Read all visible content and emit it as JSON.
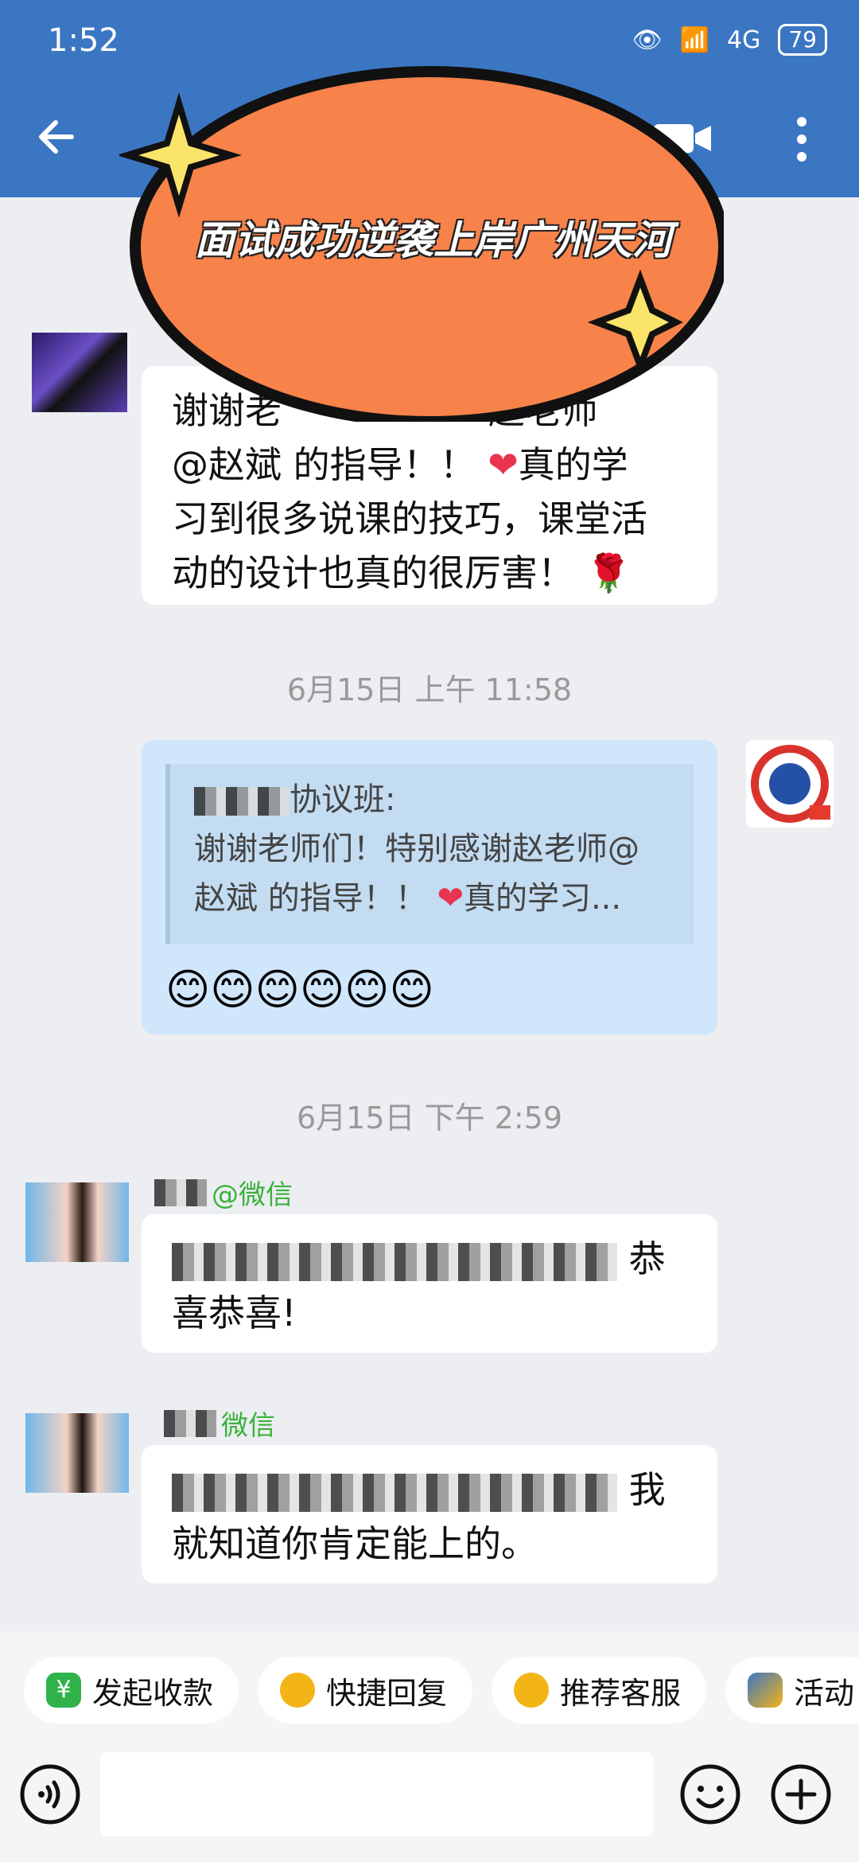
{
  "status_bar": {
    "time": "1:52",
    "network": "4G",
    "battery": "79"
  },
  "banner": {
    "text": "面试成功逆袭上岸广州天河"
  },
  "messages": {
    "first_bubble_lines": [
      "谢谢老",
      "赵老师",
      "@赵斌 的指导！！",
      "真的学",
      "习到很多说课的技巧，课堂活",
      "动的设计也真的很厉害！"
    ],
    "timestamp_1": "6月15日  上午 11:58",
    "quote": {
      "sender": "协议班:",
      "line1": "谢谢老师们！特别感谢赵老师@",
      "line2": "赵斌 的指导！！",
      "line2_end": "真的学习..."
    },
    "emoji_row": "😊😊😊😊😊😊",
    "timestamp_2": "6月15日  下午 2:59",
    "msg3": {
      "sender_suffix": "@微信",
      "text_end": "恭",
      "line2": "喜恭喜!"
    },
    "msg4": {
      "sender_suffix": "微信",
      "text_end": "我",
      "line2": "就知道你肯定能上的。"
    }
  },
  "quick_replies": [
    {
      "label": "发起收款",
      "icon": "yuan-icon",
      "color": "#2fb24a"
    },
    {
      "label": "快捷回复",
      "icon": "quick-reply-icon",
      "color": "#f3b416"
    },
    {
      "label": "推荐客服",
      "icon": "service-icon",
      "color": "#f3b416"
    },
    {
      "label": "活动",
      "icon": "activity-icon",
      "color": "#3b76c3"
    }
  ],
  "colors": {
    "header": "#3b76c3",
    "banner_fill": "#f7824a",
    "self_bubble": "#cfe6fb",
    "sender_green": "#3bb13b"
  }
}
